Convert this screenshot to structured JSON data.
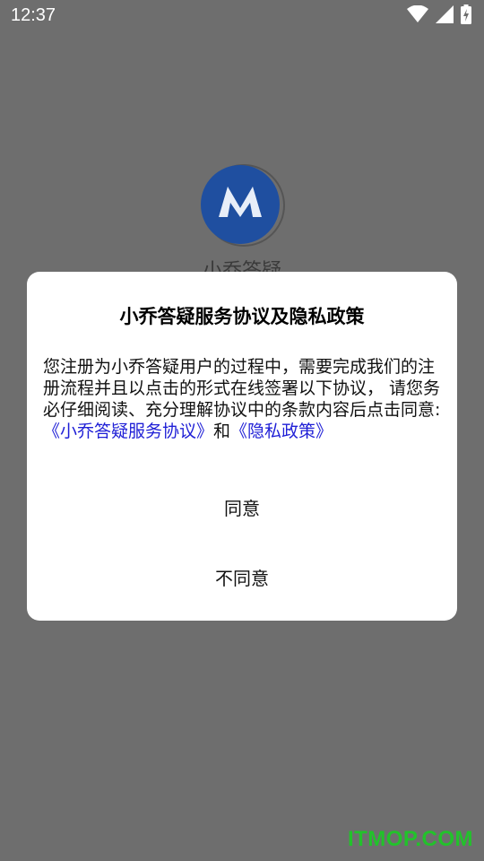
{
  "status_bar": {
    "time": "12:37",
    "icons": [
      "wifi-icon",
      "signal-icon",
      "battery-charging-icon"
    ]
  },
  "background": {
    "app_name": "小乔答疑",
    "logo_icon": "app-logo-icon",
    "logo_color": "#1f4fa0"
  },
  "dialog": {
    "title": "小乔答疑服务协议及隐私政策",
    "body_text": "您注册为小乔答疑用户的过程中，需要完成我们的注册流程并且以点击的形式在线签署以下协议， 请您务必仔细阅读、充分理解协议中的条款内容后点击同意: ",
    "service_link": "《小乔答疑服务协议》",
    "conjunction": "和",
    "privacy_link": "《隐私政策》",
    "agree_label": "同意",
    "disagree_label": "不同意"
  },
  "watermark": "ITMOP.COM",
  "colors": {
    "overlay": "#6e6e6e",
    "link": "#1f1fd6",
    "watermark": "#22c22b"
  }
}
